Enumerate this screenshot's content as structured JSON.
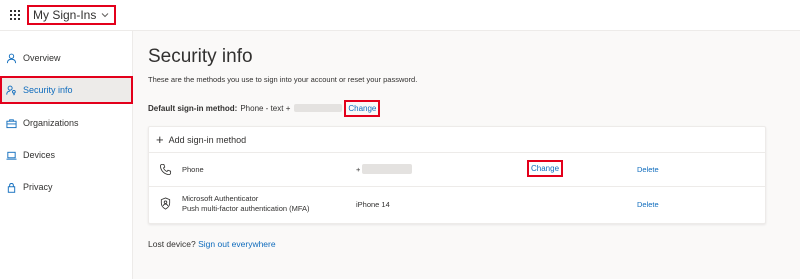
{
  "header": {
    "app_title": "My Sign-Ins",
    "icons": {
      "waffle": "app-launcher-icon",
      "chevron": "chevron-down-icon"
    }
  },
  "sidebar": {
    "items": [
      {
        "label": "Overview",
        "icon": "person-icon",
        "active": false
      },
      {
        "label": "Security info",
        "icon": "person-key-icon",
        "active": true
      },
      {
        "label": "Organizations",
        "icon": "briefcase-icon",
        "active": false
      },
      {
        "label": "Devices",
        "icon": "laptop-icon",
        "active": false
      },
      {
        "label": "Privacy",
        "icon": "lock-icon",
        "active": false
      }
    ]
  },
  "main": {
    "title": "Security info",
    "subtitle": "These are the methods you use to sign into your account or reset your password.",
    "default_method": {
      "label": "Default sign-in method:",
      "value": "Phone - text +",
      "change_label": "Change"
    },
    "add_method_label": "Add sign-in method",
    "methods": [
      {
        "icon": "phone-icon",
        "name": "Phone",
        "value": "+",
        "change_label": "Change",
        "delete_label": "Delete"
      },
      {
        "icon": "authenticator-icon",
        "name": "Microsoft Authenticator",
        "subname": "Push multi-factor authentication (MFA)",
        "value": "iPhone 14",
        "delete_label": "Delete"
      }
    ],
    "lost_device": {
      "text": "Lost device?",
      "link": "Sign out everywhere"
    }
  },
  "colors": {
    "accent": "#0f6cbd",
    "highlight_border": "#e3001b",
    "page_bg": "#faf9f8",
    "active_nav_bg": "#edebe9"
  }
}
